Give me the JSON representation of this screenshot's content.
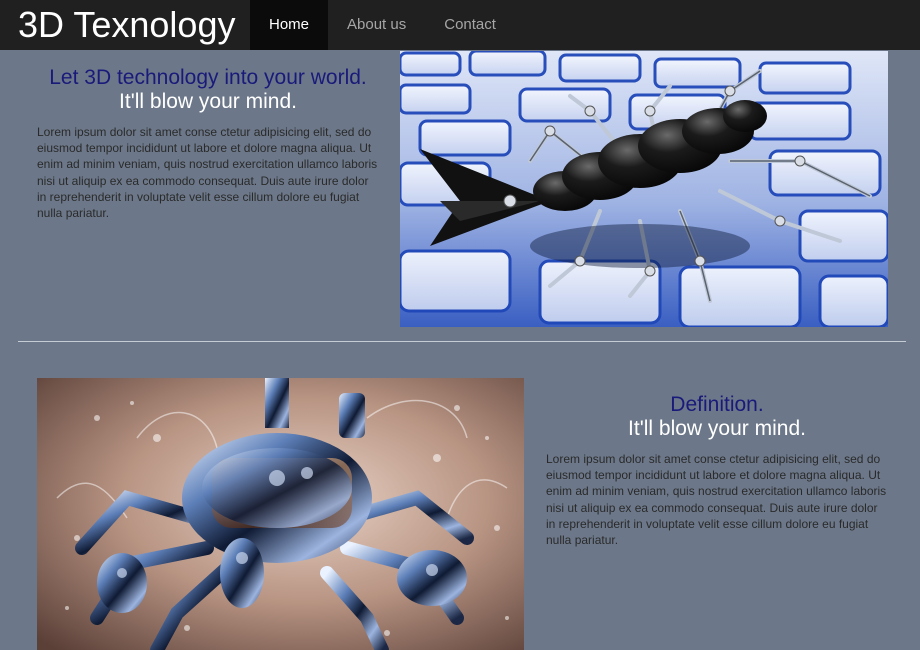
{
  "header": {
    "brand": "3D Texnology",
    "nav": [
      {
        "label": "Home",
        "active": true
      },
      {
        "label": "About us",
        "active": false
      },
      {
        "label": "Contact",
        "active": false
      }
    ]
  },
  "section1": {
    "title": "Let 3D technology into your world.",
    "subtitle": "It'll blow your mind.",
    "body": "Lorem ipsum dolor sit amet conse ctetur adipisicing elit, sed do eiusmod tempor incididunt ut labore et dolore magna aliqua. Ut enim ad minim veniam, quis nostrud exercitation ullamco laboris nisi ut aliquip ex ea commodo consequat. Duis aute irure dolor in reprehenderit in voluptate velit esse cillum dolore eu fugiat nulla pariatur."
  },
  "section2": {
    "title": "Definition.",
    "subtitle": "It'll blow your mind.",
    "body": "Lorem ipsum dolor sit amet conse ctetur adipisicing elit, sed do eiusmod tempor incididunt ut labore et dolore magna aliqua. Ut enim ad minim veniam, quis nostrud exercitation ullamco laboris nisi ut aliquip ex ea commodo consequat. Duis aute irure dolor in reprehenderit in voluptate velit esse cillum dolore eu fugiat nulla pariatur."
  },
  "colors": {
    "background": "#6c7889",
    "header": "#202020",
    "nav_active": "#0b0b0b",
    "title_blue": "#1a1a7a",
    "white": "#ffffff"
  }
}
